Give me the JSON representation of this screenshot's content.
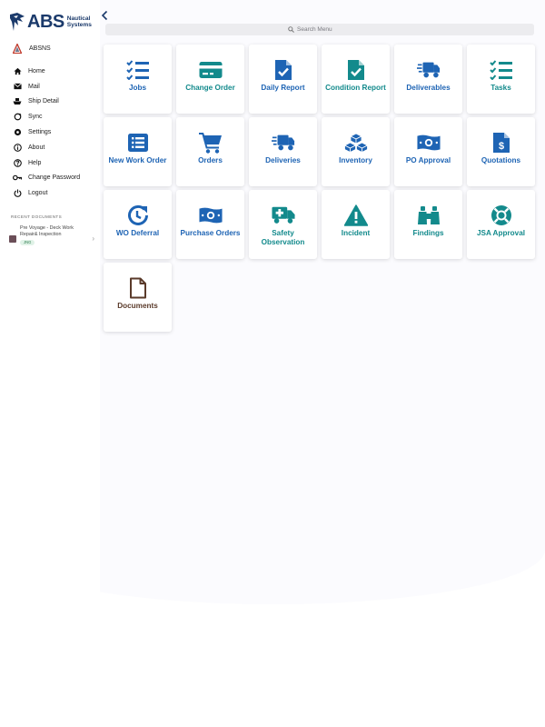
{
  "brand": {
    "name": "ABS",
    "sub_line1": "Nautical",
    "sub_line2": "Systems"
  },
  "user": {
    "name": "ABSNS"
  },
  "nav": [
    {
      "label": "Home",
      "icon": "home-icon"
    },
    {
      "label": "Mail",
      "icon": "mail-icon"
    },
    {
      "label": "Ship Detail",
      "icon": "ship-icon"
    },
    {
      "label": "Sync",
      "icon": "sync-icon"
    },
    {
      "label": "Settings",
      "icon": "settings-icon"
    },
    {
      "label": "About",
      "icon": "info-icon"
    },
    {
      "label": "Help",
      "icon": "help-icon"
    },
    {
      "label": "Change Password",
      "icon": "key-icon"
    },
    {
      "label": "Logout",
      "icon": "power-icon"
    }
  ],
  "recent": {
    "heading": "RECENT DOCUMENTS",
    "items": [
      {
        "title": "Pre Voyage - Deck Work Repair& Inspection",
        "badge": "JNG"
      }
    ]
  },
  "search": {
    "placeholder": "Search Menu"
  },
  "tiles": [
    {
      "label": "Jobs",
      "icon": "checklist-icon",
      "color": "#1e64b4"
    },
    {
      "label": "Change Order",
      "icon": "credit-card-icon",
      "color": "#138a8c"
    },
    {
      "label": "Daily Report",
      "icon": "file-check-icon",
      "color": "#1e64b4"
    },
    {
      "label": "Condition Report",
      "icon": "file-check-icon",
      "color": "#138a8c"
    },
    {
      "label": "Deliverables",
      "icon": "fast-truck-icon",
      "color": "#1e64b4"
    },
    {
      "label": "Tasks",
      "icon": "checklist-icon",
      "color": "#138a8c"
    },
    {
      "label": "New Work Order",
      "icon": "list-icon",
      "color": "#1e64b4"
    },
    {
      "label": "Orders",
      "icon": "cart-icon",
      "color": "#1e64b4"
    },
    {
      "label": "Deliveries",
      "icon": "fast-truck-icon",
      "color": "#1e64b4"
    },
    {
      "label": "Inventory",
      "icon": "boxes-icon",
      "color": "#1e64b4"
    },
    {
      "label": "PO Approval",
      "icon": "money-icon",
      "color": "#1e64b4"
    },
    {
      "label": "Quotations",
      "icon": "invoice-icon",
      "color": "#1e64b4"
    },
    {
      "label": "WO Deferral",
      "icon": "clock-redo-icon",
      "color": "#1e64b4"
    },
    {
      "label": "Purchase Orders",
      "icon": "money-icon",
      "color": "#1e64b4"
    },
    {
      "label": "Safety Observation",
      "icon": "ambulance-icon",
      "color": "#138a8c"
    },
    {
      "label": "Incident",
      "icon": "warning-icon",
      "color": "#138a8c"
    },
    {
      "label": "Findings",
      "icon": "binoculars-icon",
      "color": "#138a8c"
    },
    {
      "label": "JSA Approval",
      "icon": "lifering-icon",
      "color": "#138a8c"
    },
    {
      "label": "Documents",
      "icon": "document-icon",
      "color": "#5a3a2a"
    }
  ]
}
